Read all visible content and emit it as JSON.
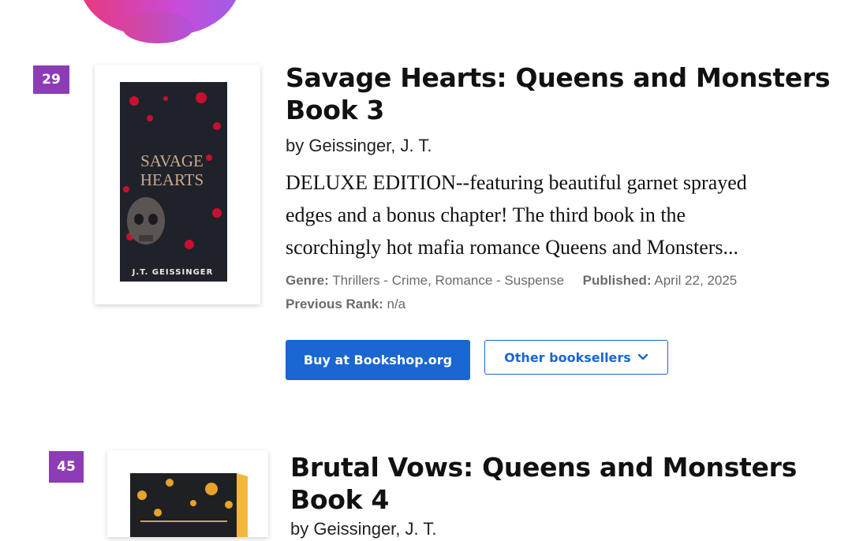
{
  "books": [
    {
      "rank": "29",
      "title_line1": "Savage Hearts: Queens and Monsters",
      "title_line2": "Book 3",
      "author": "by Geissinger, J. T.",
      "description_lines": [
        "DELUXE EDITION--featuring beautiful garnet sprayed",
        "edges and a bonus chapter! The third book in the",
        "scorchingly hot mafia romance Queens and Monsters..."
      ],
      "genre_label": "Genre:",
      "genre_value": "Thrillers - Crime, Romance - Suspense",
      "published_label": "Published:",
      "published_value": "April 22, 2025",
      "previous_rank_label": "Previous Rank:",
      "previous_rank_value": "n/a",
      "cover": {
        "title_lines": [
          "SAVAGE",
          "HEARTS"
        ],
        "author": "J.T. GEISSINGER",
        "edge_color": "#d4146f",
        "accent_color": "#c8102e"
      }
    },
    {
      "rank": "45",
      "title_line1": "Brutal Vows: Queens and Monsters",
      "title_line2": "Book 4",
      "author": "by Geissinger, J. T.",
      "cover": {
        "edge_color": "#f1b93a",
        "accent_color": "#e8a22a"
      }
    }
  ],
  "buttons": {
    "buy_label": "Buy at Bookshop.org",
    "other_label": "Other booksellers"
  },
  "colors": {
    "rank_badge": "#8d3cb5",
    "primary_button": "#1a66d2"
  }
}
